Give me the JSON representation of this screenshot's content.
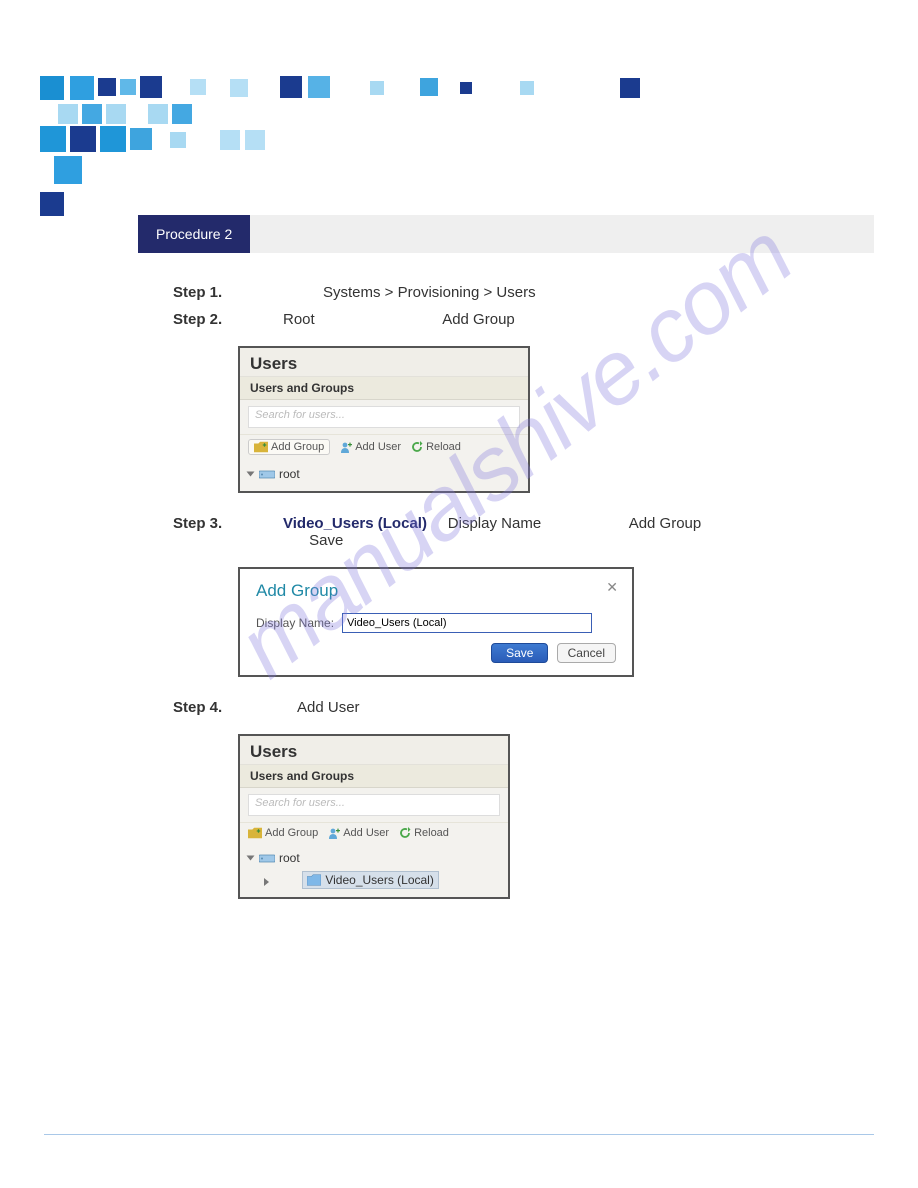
{
  "watermark": "manualshive.com",
  "procedure": {
    "label": "Procedure 2"
  },
  "steps": {
    "s1": {
      "label": "Step 1.",
      "nav": "Systems > Provisioning > Users"
    },
    "s2": {
      "label": "Step 2.",
      "root": "Root",
      "add_group": "Add Group"
    },
    "s3": {
      "label": "Step 3.",
      "group_name": "Video_Users (Local)",
      "display_name": "Display Name",
      "add_group": "Add Group",
      "save": "Save"
    },
    "s4": {
      "label": "Step 4.",
      "add_user": "Add User"
    }
  },
  "panel1": {
    "title": "Users",
    "subtitle": "Users and Groups",
    "search_placeholder": "Search for users...",
    "btn_add_group": "Add Group",
    "btn_add_user": "Add User",
    "btn_reload": "Reload",
    "tree_root": "root"
  },
  "dialog": {
    "title": "Add Group",
    "field_label": "Display Name:",
    "field_value": "Video_Users (Local)",
    "save": "Save",
    "cancel": "Cancel"
  },
  "panel3": {
    "title": "Users",
    "subtitle": "Users and Groups",
    "search_placeholder": "Search for users...",
    "btn_add_group": "Add Group",
    "btn_add_user": "Add User",
    "btn_reload": "Reload",
    "tree_root": "root",
    "tree_child": "Video_Users (Local)"
  }
}
